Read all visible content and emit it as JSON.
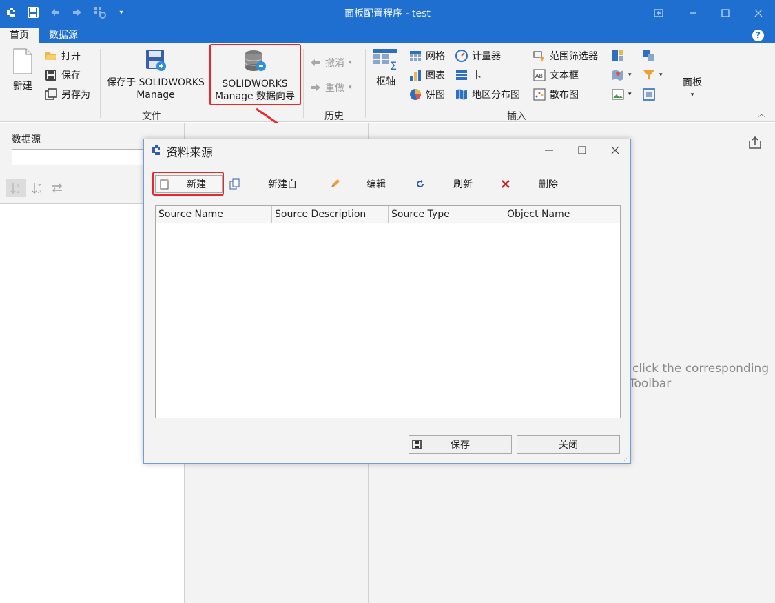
{
  "window": {
    "title": "面板配置程序 - test"
  },
  "tabs": [
    {
      "label": "首页",
      "active": true
    },
    {
      "label": "数据源",
      "active": false
    }
  ],
  "ribbon": {
    "new_label": "新建",
    "open_label": "打开",
    "save_label": "保存",
    "save_as_label": "另存为",
    "save_to_sw_line1": "保存于 SOLIDWORKS",
    "save_to_sw_line2": "Manage",
    "wizard_line1": "SOLIDWORKS",
    "wizard_line2": "Manage 数据向导",
    "group_file": "文件",
    "undo_label": "撤消",
    "redo_label": "重做",
    "group_history": "历史",
    "pivot_label": "枢轴",
    "grid_label": "网格",
    "chart_label": "图表",
    "pie_label": "饼图",
    "gauge_label": "计量器",
    "card_label": "卡",
    "map_label": "地区分布图",
    "range_filter_label": "范围筛选器",
    "textbox_label": "文本框",
    "scatter_label": "散布图",
    "group_insert": "插入",
    "panel_label": "面板"
  },
  "left_panel": {
    "title": "数据源",
    "dropdown_value": ""
  },
  "right_panel": {
    "hint_line1": "click the corresponding",
    "hint_line2": "Toolbar"
  },
  "dialog": {
    "title": "资料来源",
    "toolbar": {
      "new_label": "新建",
      "new_from_label": "新建自",
      "edit_label": "编辑",
      "refresh_label": "刷新",
      "delete_label": "删除"
    },
    "columns": [
      "Source Name",
      "Source Description",
      "Source Type",
      "Object Name"
    ],
    "rows": [],
    "save_label": "保存",
    "close_label": "关闭"
  },
  "colors": {
    "title_bar": "#1e6fd0",
    "highlight_red": "#e8262b",
    "accent_orange": "#f0a030"
  }
}
